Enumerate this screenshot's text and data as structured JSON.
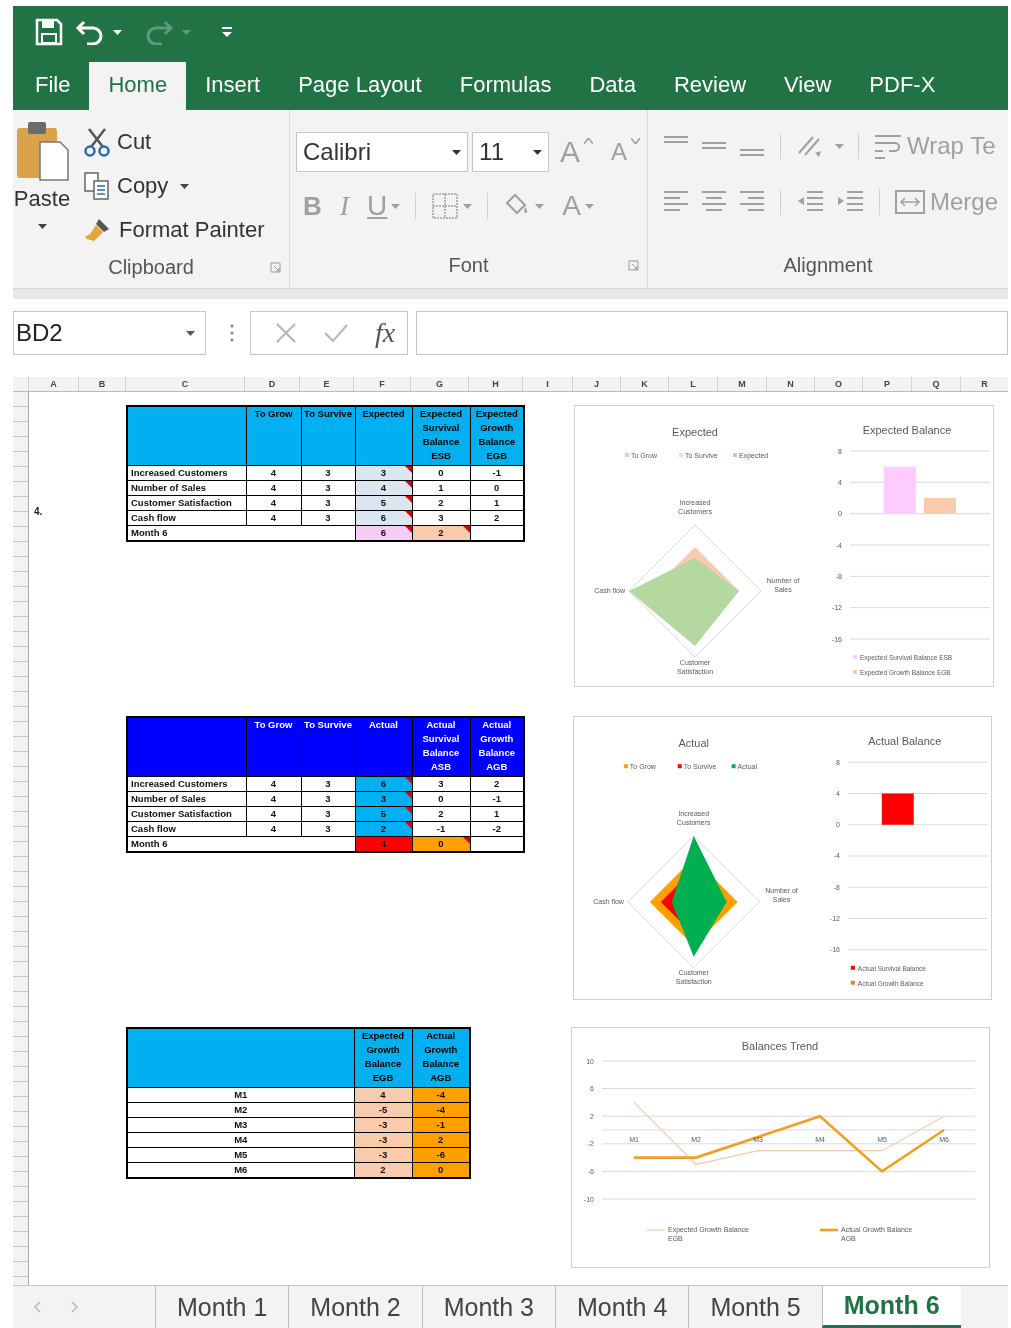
{
  "quick_access": {
    "redo_disabled": true
  },
  "ribbon_tabs": [
    {
      "label": "File",
      "selected": false
    },
    {
      "label": "Home",
      "selected": true
    },
    {
      "label": "Insert",
      "selected": false
    },
    {
      "label": "Page Layout",
      "selected": false
    },
    {
      "label": "Formulas",
      "selected": false
    },
    {
      "label": "Data",
      "selected": false
    },
    {
      "label": "Review",
      "selected": false
    },
    {
      "label": "View",
      "selected": false
    },
    {
      "label": "PDF-X",
      "selected": false
    }
  ],
  "ribbon": {
    "clipboard": {
      "label": "Clipboard",
      "paste": "Paste",
      "cut": "Cut",
      "copy": "Copy",
      "format_painter": "Format Painter"
    },
    "font": {
      "label": "Font",
      "font_name": "Calibri",
      "font_size": "11",
      "grow": "A",
      "shrink": "A",
      "bold": "B",
      "italic": "I",
      "underline": "U",
      "font_color": "A",
      "disabled": true
    },
    "alignment": {
      "label": "Alignment",
      "wrap_text": "Wrap Te",
      "merge": "Merge",
      "disabled": true
    }
  },
  "formula_bar": {
    "name_box": "BD2",
    "fx": "fx"
  },
  "column_headers": [
    "A",
    "B",
    "C",
    "D",
    "E",
    "F",
    "G",
    "H",
    "I",
    "J",
    "K",
    "L",
    "M",
    "N",
    "O",
    "P",
    "Q",
    "R"
  ],
  "sections": [
    {
      "column_a_text": "4.",
      "table": {
        "kind": "scorecard",
        "header": {
          "color": "#00b0f0"
        },
        "columns": [
          {
            "label": "To Grow",
            "note": false
          },
          {
            "label": "To Survive",
            "note": false
          },
          {
            "label": "Expected",
            "color": "#dce6f1",
            "note": true
          },
          {
            "label": "Expected Survival Balance ESB",
            "note": false
          },
          {
            "label": "Expected Growth Balance EGB",
            "note": false
          }
        ],
        "rows": [
          {
            "label": "Increased Customers",
            "cells": [
              "4",
              "3",
              "3",
              "0",
              "-1"
            ]
          },
          {
            "label": "Number of Sales",
            "cells": [
              "4",
              "3",
              "4",
              "1",
              "0"
            ]
          },
          {
            "label": "Customer Satisfaction",
            "cells": [
              "4",
              "3",
              "5",
              "2",
              "1"
            ]
          },
          {
            "label": "Cash flow",
            "cells": [
              "4",
              "3",
              "6",
              "3",
              "2"
            ]
          }
        ],
        "summary": {
          "label": "Month 6",
          "cells": [
            {
              "value": "6",
              "color": "#f6ccf4",
              "note": true
            },
            {
              "value": "2",
              "color": "#f8cbad",
              "note": true
            }
          ]
        }
      },
      "chart": {
        "kind": "radar_bar",
        "radar": {
          "title": "Expected",
          "legend": [
            {
              "name": "To Grow",
              "color": "#f8cbad"
            },
            {
              "name": "To Survive",
              "color": "#ffccff"
            },
            {
              "name": "Expected",
              "color": "#b4d8a0"
            }
          ],
          "axes": [
            "Increased Customers",
            "Number of Sales",
            "Customer Satisfaction",
            "Cash flow"
          ]
        },
        "balance": {
          "chart_data": {
            "type": "bar",
            "title": "Expected Balance",
            "ylim": [
              -16,
              8
            ],
            "yticks": [
              8,
              4,
              0,
              -4,
              -8,
              -12,
              -16
            ],
            "grid": true,
            "legend": true,
            "series": [
              {
                "name": "Expected Survival Balance ESB",
                "color": "#ffccff",
                "values": [
                  6
                ]
              },
              {
                "name": "Expected Growth Balance EGB",
                "color": "#f8cbad",
                "values": [
                  2
                ]
              }
            ]
          }
        }
      }
    },
    {
      "table": {
        "kind": "scorecard",
        "header": {
          "color": "#0000ff"
        },
        "columns": [
          {
            "label": "To Grow",
            "note": false
          },
          {
            "label": "To Survive",
            "note": false
          },
          {
            "label": "Actual",
            "color": "#00b0f0",
            "note": true
          },
          {
            "label": "Actual Survival Balance ASB",
            "note": false
          },
          {
            "label": "Actual Growth Balance AGB",
            "note": false
          }
        ],
        "rows": [
          {
            "label": "Increased Customers",
            "cells": [
              "4",
              "3",
              "6",
              "3",
              "2"
            ]
          },
          {
            "label": "Number of Sales",
            "cells": [
              "4",
              "3",
              "3",
              "0",
              "-1"
            ]
          },
          {
            "label": "Customer Satisfaction",
            "cells": [
              "4",
              "3",
              "5",
              "2",
              "1"
            ]
          },
          {
            "label": "Cash flow",
            "cells": [
              "4",
              "3",
              "2",
              "-1",
              "-2"
            ]
          }
        ],
        "summary": {
          "label": "Month 6",
          "cells": [
            {
              "value": "4",
              "color": "#ff0000",
              "note": false
            },
            {
              "value": "0",
              "color": "#ffa000",
              "note": true
            }
          ]
        }
      },
      "chart": {
        "kind": "radar_bar",
        "radar": {
          "title": "Actual",
          "legend": [
            {
              "name": "To Grow",
              "color": "#ffa000"
            },
            {
              "name": "To Survive",
              "color": "#ff0000"
            },
            {
              "name": "Actual",
              "color": "#00b050"
            }
          ],
          "axes": [
            "Increased Customers",
            "Number of Sales",
            "Customer Satisfaction",
            "Cash flow"
          ]
        },
        "balance": {
          "chart_data": {
            "type": "bar",
            "title": "Actual Balance",
            "ylim": [
              -16,
              8
            ],
            "yticks": [
              8,
              4,
              0,
              -4,
              -8,
              -12,
              -16
            ],
            "grid": true,
            "legend": true,
            "series": [
              {
                "name": "Actual Survival Balance",
                "color": "#ff0000",
                "values": [
                  4
                ]
              },
              {
                "name": "Actual Growth Balance",
                "color": "#ed7d31",
                "values": [
                  0
                ]
              }
            ]
          }
        }
      }
    },
    {
      "table": {
        "kind": "trend",
        "header": {
          "color": "#00b0f0"
        },
        "columns": [
          {
            "label": "Expected Growth Balance EGB",
            "color": "#f8cbad",
            "note": false
          },
          {
            "label": "Actual Growth Balance AGB",
            "color": "#ffa000",
            "note": false
          }
        ],
        "rows": [
          {
            "label": "M1",
            "cells": [
              "4",
              "-4"
            ]
          },
          {
            "label": "M2",
            "cells": [
              "-5",
              "-4"
            ]
          },
          {
            "label": "M3",
            "cells": [
              "-3",
              "-1"
            ]
          },
          {
            "label": "M4",
            "cells": [
              "-3",
              "2"
            ]
          },
          {
            "label": "M5",
            "cells": [
              "-3",
              "-6"
            ]
          },
          {
            "label": "M6",
            "cells": [
              "2",
              "0"
            ]
          }
        ]
      },
      "chart": {
        "kind": "plain",
        "chart_data": {
          "type": "line",
          "title": "Balances Trend",
          "categories": [
            "M1",
            "M2",
            "M3",
            "M4",
            "M5",
            "M6"
          ],
          "ylim": [
            -10,
            10
          ],
          "yticks": [
            10,
            6,
            2,
            -2,
            -6,
            -10
          ],
          "grid": true,
          "legend": true,
          "series": [
            {
              "name": "Expected Growth Balance EGB",
              "color": "#f8cbad",
              "values": [
                4,
                -5,
                -3,
                -3,
                -3,
                2
              ]
            },
            {
              "name": "Actual Growth Balance AGB",
              "color": "#f0a020",
              "values": [
                -4,
                -4,
                -1,
                2,
                -6,
                0
              ]
            }
          ]
        }
      }
    }
  ],
  "sheet_tabs": [
    {
      "label": "Month 1",
      "selected": false
    },
    {
      "label": "Month 2",
      "selected": false
    },
    {
      "label": "Month 3",
      "selected": false
    },
    {
      "label": "Month 4",
      "selected": false
    },
    {
      "label": "Month 5",
      "selected": false
    },
    {
      "label": "Month 6",
      "selected": true
    }
  ]
}
